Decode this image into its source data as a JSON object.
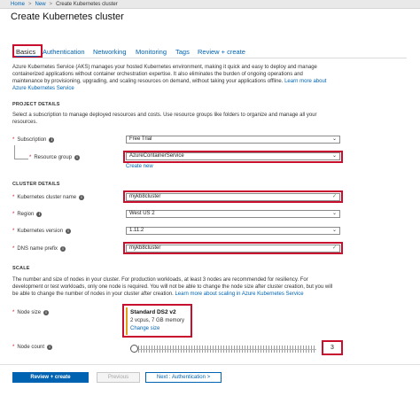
{
  "breadcrumb": {
    "home": "Home",
    "sep1": ">",
    "new": "New",
    "sep2": ">",
    "current": "Create Kubernetes cluster"
  },
  "page_title": "Create Kubernetes cluster",
  "tabs": {
    "basics": "Basics",
    "authentication": "Authentication",
    "networking": "Networking",
    "monitoring": "Monitoring",
    "tags": "Tags",
    "review": "Review + create"
  },
  "intro": {
    "line1": "Azure Kubernetes Service (AKS) manages your hosted Kubernetes environment, making it quick and easy to deploy and manage",
    "line2": "containerized applications without container orchestration expertise. It also eliminates the burden of ongoing operations and",
    "line3": "maintenance by provisioning, upgrading, and scaling resources on demand, without taking your applications offline.",
    "learn_more": "Learn more about",
    "line4": "Azure Kubernetes Service"
  },
  "project_details": {
    "heading": "PROJECT DETAILS",
    "desc_line1": "Select a subscription to manage deployed resources and costs. Use resource groups like folders to organize and manage all your",
    "desc_line2": "resources.",
    "subscription_label": "Subscription",
    "subscription_value": "Free Trial",
    "resource_group_label": "Resource group",
    "resource_group_value": "AzureContainerService",
    "create_new": "Create new"
  },
  "cluster_details": {
    "heading": "CLUSTER DETAILS",
    "name_label": "Kubernetes cluster name",
    "name_value": "mykb8cluster",
    "region_label": "Region",
    "region_value": "West US 2",
    "version_label": "Kubernetes version",
    "version_value": "1.11.2",
    "dns_label": "DNS name prefix",
    "dns_value": "mykb8cluster"
  },
  "scale": {
    "heading": "SCALE",
    "desc_line1": "The number and size of nodes in your cluster. For production workloads, at least 3 nodes are recommended for resiliency. For",
    "desc_line2": "development or test workloads, only one node is required. You will not be able to change the node size after cluster creation, but you will",
    "desc_line3": "be able to change the number of nodes in your cluster after creation.",
    "learn_more": "Learn more about scaling in Azure Kubernetes Service",
    "node_size_label": "Node size",
    "node_size_name": "Standard DS2 v2",
    "node_size_spec": "2 vcpus, 7 GB memory",
    "change_size": "Change size",
    "node_count_label": "Node count",
    "node_count_value": "3"
  },
  "footer": {
    "review_button": "Review + create",
    "previous_button": "Previous",
    "next_button": "Next : Authentication >"
  },
  "icons": {
    "info": "info-icon",
    "chevron": "chevron-down-icon",
    "check": "checkmark-icon"
  },
  "colors": {
    "accent": "#0063b1",
    "highlight": "#c8102e",
    "size_bar": "#e0a01a",
    "valid": "#3a8d3a"
  }
}
